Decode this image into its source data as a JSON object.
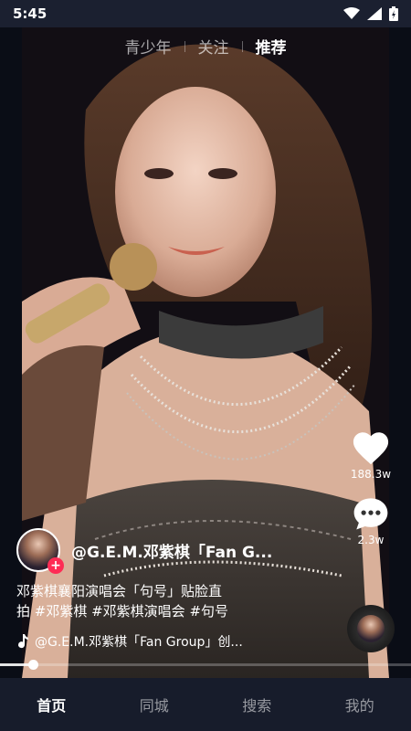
{
  "status": {
    "time": "5:45"
  },
  "top_tabs": [
    {
      "label": "青少年",
      "active": false
    },
    {
      "label": "关注",
      "active": false
    },
    {
      "label": "推荐",
      "active": true
    }
  ],
  "actions": {
    "like_count": "188.3w",
    "comment_count": "2.3w"
  },
  "author": {
    "name": "@G.E.M.邓紫棋「Fan G..."
  },
  "caption": {
    "line1": "邓紫棋襄阳演唱会「句号」贴脸直",
    "line2": "拍 #邓紫棋 #邓紫棋演唱会 #句号"
  },
  "music": {
    "text": "@G.E.M.邓紫棋「Fan Group」创..."
  },
  "progress": {
    "fraction": 0.08
  },
  "bottom_nav": [
    {
      "label": "首页",
      "active": true
    },
    {
      "label": "同城",
      "active": false
    },
    {
      "label": "搜索",
      "active": false
    },
    {
      "label": "我的",
      "active": false
    }
  ],
  "colors": {
    "accent": "#fe2c55",
    "nav_bg": "#171c2b",
    "status_bg": "#1b2030"
  },
  "icons": [
    "wifi-icon",
    "signal-icon",
    "battery-icon",
    "heart-icon",
    "comment-icon",
    "music-note-icon",
    "plus-icon"
  ]
}
